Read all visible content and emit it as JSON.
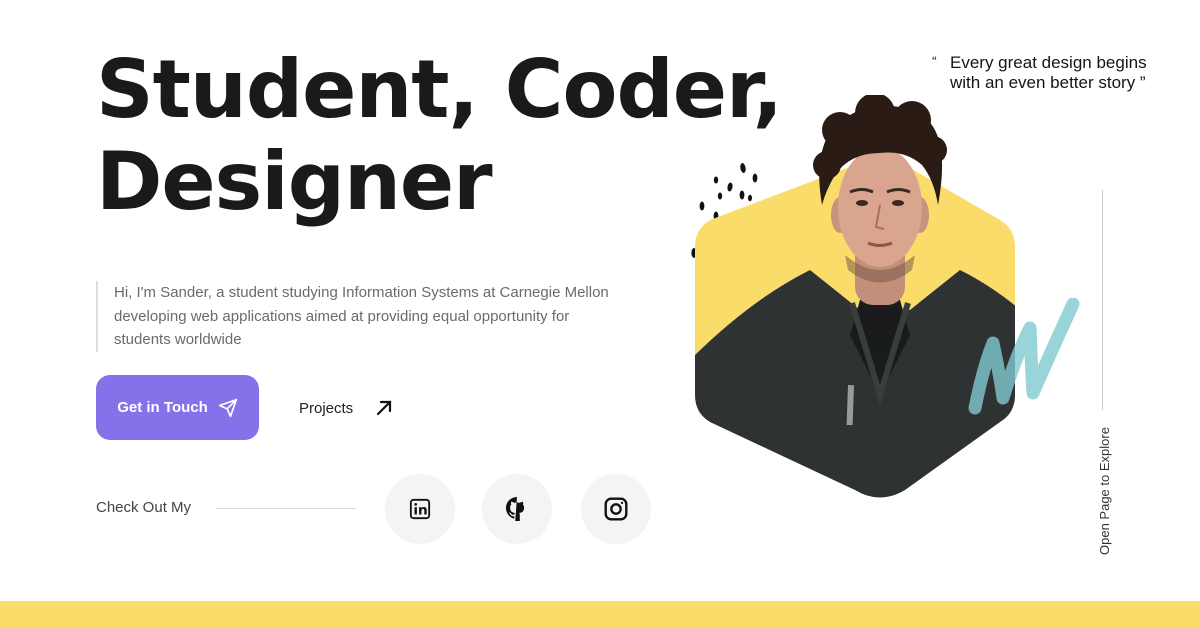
{
  "hero": {
    "title_line1": "Student, Coder,",
    "title_line2": "Designer",
    "intro": "Hi, I'm Sander, a student studying Information Systems at Carnegie Mellon developing web applications aimed at providing equal opportunity for students worldwide"
  },
  "actions": {
    "get_in_touch": "Get in Touch",
    "projects": "Projects"
  },
  "social": {
    "label": "Check Out My",
    "links": [
      {
        "name": "linkedin",
        "icon": "linkedin-icon"
      },
      {
        "name": "github",
        "icon": "github-icon"
      },
      {
        "name": "instagram",
        "icon": "instagram-icon"
      }
    ]
  },
  "quote": {
    "open_mark": "“",
    "text": "Every great design begins with an even better story ”"
  },
  "side": {
    "explore": "Open Page to Explore"
  },
  "colors": {
    "accent": "#8472ea",
    "hexagon": "#fadc6b",
    "footer_band": "#fadc6b",
    "squiggle": "#7fc9cf"
  }
}
